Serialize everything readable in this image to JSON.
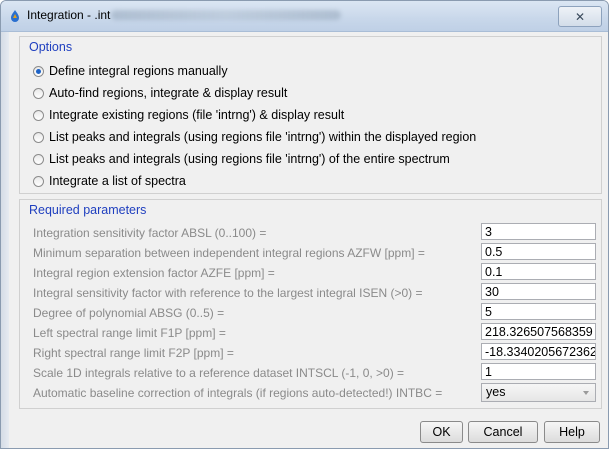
{
  "window": {
    "title": "Integration - .int",
    "close_label": "✕"
  },
  "options": {
    "title": "Options",
    "items": [
      {
        "label": "Define integral regions manually",
        "checked": true
      },
      {
        "label": "Auto-find regions, integrate & display result",
        "checked": false
      },
      {
        "label": "Integrate existing regions (file 'intrng') & display result",
        "checked": false
      },
      {
        "label": "List peaks and integrals (using regions file 'intrng') within the displayed region",
        "checked": false
      },
      {
        "label": "List peaks and integrals (using regions file 'intrng') of the entire spectrum",
        "checked": false
      },
      {
        "label": "Integrate a list of spectra",
        "checked": false
      }
    ]
  },
  "params": {
    "title": "Required parameters",
    "rows": [
      {
        "label": "Integration sensitivity factor ABSL (0..100) =",
        "value": "3"
      },
      {
        "label": "Minimum separation between independent integral regions AZFW [ppm] =",
        "value": "0.5"
      },
      {
        "label": "Integral region extension factor AZFE [ppm] =",
        "value": "0.1"
      },
      {
        "label": "Integral sensitivity factor with reference to the largest integral ISEN (>0) =",
        "value": "30"
      },
      {
        "label": "Degree of polynomial ABSG (0..5) =",
        "value": "5"
      },
      {
        "label": "Left spectral range limit F1P [ppm] =",
        "value": "218.326507568359"
      },
      {
        "label": "Right spectral range limit F2P [ppm] =",
        "value": "-18.3340205672362"
      },
      {
        "label": "Scale 1D integrals relative to a reference dataset INTSCL (-1, 0, >0) =",
        "value": "1"
      },
      {
        "label": "Automatic baseline correction of integrals (if regions auto-detected!) INTBC =",
        "value": "yes"
      }
    ]
  },
  "buttons": {
    "ok": "OK",
    "cancel": "Cancel",
    "help": "Help"
  },
  "icons": {
    "app": "topspin-app-icon",
    "close": "close-icon",
    "dropdown": "chevron-down-icon"
  }
}
